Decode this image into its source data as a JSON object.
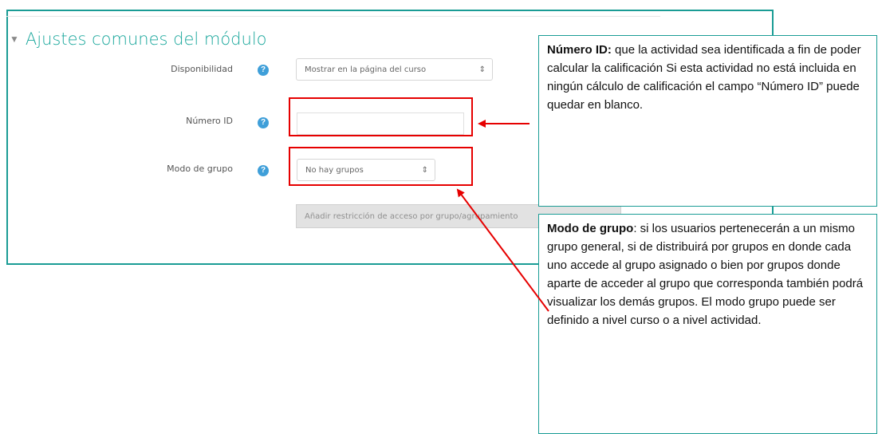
{
  "section": {
    "title": "Ajustes comunes del módulo",
    "chevron": "▼"
  },
  "fields": {
    "availability": {
      "label": "Disponibilidad",
      "value": "Mostrar en la página del curso",
      "arrow": "⇕"
    },
    "id_number": {
      "label": "Número ID",
      "value": ""
    },
    "group_mode": {
      "label": "Modo de grupo",
      "value": "No hay grupos",
      "arrow": "⇕"
    },
    "help_icon": "?"
  },
  "restrict_button": {
    "label": "Añadir restricción de acceso por grupo/agrupamiento"
  },
  "callouts": {
    "id_number": {
      "title": "Número ID:",
      "text": " que la actividad sea identificada a fin de poder calcular la calificación Si esta actividad no está incluida en ningún cálculo de calificación el campo “Número ID” puede quedar en blanco."
    },
    "group_mode": {
      "title": "Modo de grupo",
      "text": ": si los usuarios pertenecerán a un mismo grupo general, si de distribuirá por grupos en donde cada uno accede al grupo asignado o bien por grupos donde aparte de acceder al grupo que corresponda también podrá visualizar los demás grupos. El modo grupo puede ser definido a nivel curso o a nivel actividad."
    }
  },
  "colors": {
    "accent": "#1aa79c",
    "highlight": "#e60000",
    "help": "#3f9fd9"
  }
}
